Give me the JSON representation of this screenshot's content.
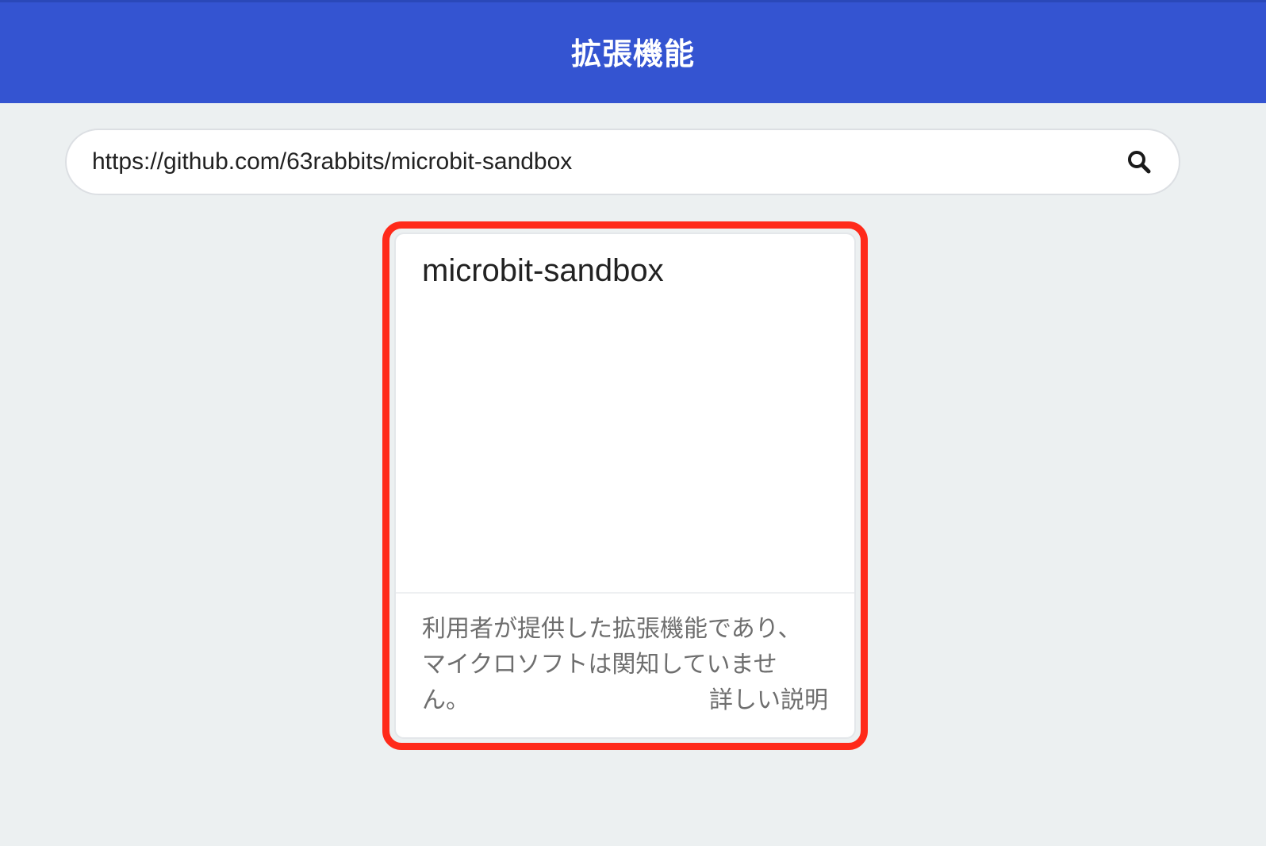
{
  "header": {
    "title": "拡張機能"
  },
  "search": {
    "value": "https://github.com/63rabbits/microbit-sandbox",
    "icon": "search-icon"
  },
  "card": {
    "title": "microbit-sandbox",
    "description": "利用者が提供した拡張機能であり、マイクロソフトは関知していません。",
    "learn_more": "詳しい説明"
  },
  "colors": {
    "header_bg": "#3454d1",
    "page_bg": "#ecf0f1",
    "highlight": "#ff2a1a"
  }
}
